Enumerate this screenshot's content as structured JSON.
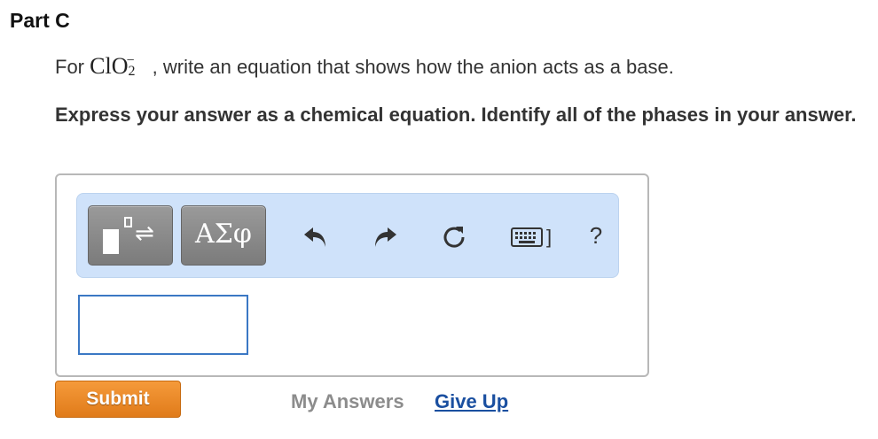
{
  "part": {
    "title": "Part C"
  },
  "question": {
    "prefix": "For",
    "formula_base": "ClO",
    "formula_sub": "2",
    "formula_sup": "−",
    "suffix": ", write an equation that shows how the anion acts as a base."
  },
  "instructions": {
    "text": "Express your answer as a chemical equation. Identify all of the phases in your answer."
  },
  "toolbar": {
    "templates_icon": "templates-reaction-arrows-icon",
    "symbols_label": "ΑΣφ",
    "undo_icon": "undo-icon",
    "redo_icon": "redo-icon",
    "reset_icon": "reset-icon",
    "keyboard_icon": "keyboard-shortcuts-icon",
    "keyboard_bracket": "]",
    "help_label": "?",
    "background_color": "#cfe2fa"
  },
  "answer": {
    "value": ""
  },
  "actions": {
    "submit_label": "Submit",
    "submit_color": "#ee8a2a",
    "my_answers_label": "My Answers",
    "give_up_label": "Give Up",
    "give_up_color": "#1a4fa0"
  }
}
